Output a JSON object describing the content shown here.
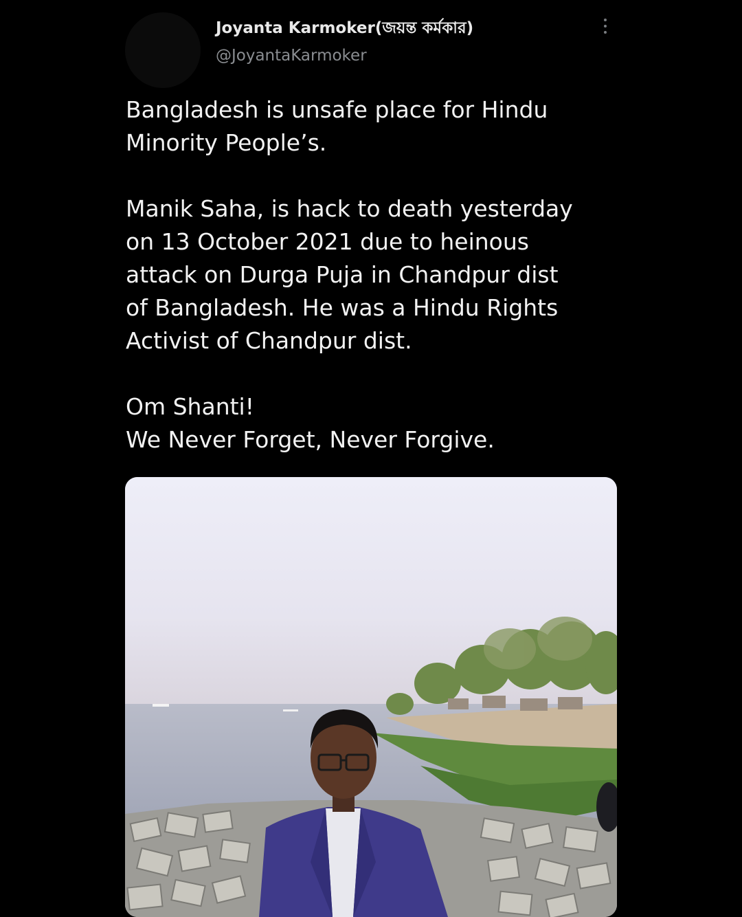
{
  "tweet": {
    "author": {
      "display_name": "Joyanta Karmoker(জয়ন্ত কর্মকার)",
      "handle": "@JoyantaKarmoker"
    },
    "more_icon": "more-vertical-icon",
    "text": {
      "para1_line1": "Bangladesh is unsafe place for Hindu",
      "para1_line2": "Minority People’s.",
      "para2_line1": "Manik Saha, is hack to death yesterday",
      "para2_line2": "on 13 October 2021 due to heinous",
      "para2_line3": "attack on Durga Puja in Chandpur dist",
      "para2_line4": "of Bangladesh. He was a Hindu Rights",
      "para2_line5": "Activist of Chandpur dist.",
      "para3_line1": "Om Shanti!",
      "para3_line2": "We Never Forget, Never Forgive."
    }
  },
  "colors": {
    "background": "#000000",
    "text_primary": "#f2f2f2",
    "text_secondary": "#8a8d91"
  }
}
